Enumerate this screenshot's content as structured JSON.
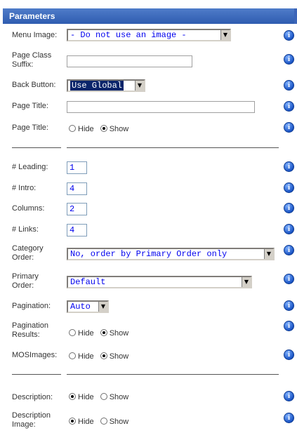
{
  "header": {
    "title": "Parameters"
  },
  "rows": {
    "menu_image": {
      "label": "Menu Image:",
      "value": "- Do not use an image -"
    },
    "page_class_suffix": {
      "label": "Page Class Suffix:",
      "value": ""
    },
    "back_button": {
      "label": "Back Button:",
      "value": "Use Global"
    },
    "page_title_text": {
      "label": "Page Title:",
      "value": ""
    },
    "page_title_show": {
      "label": "Page Title:",
      "hide": "Hide",
      "show": "Show",
      "selected": "Show"
    },
    "leading": {
      "label": "# Leading:",
      "value": "1"
    },
    "intro": {
      "label": "# Intro:",
      "value": "4"
    },
    "columns": {
      "label": "Columns:",
      "value": "2"
    },
    "links": {
      "label": "# Links:",
      "value": "4"
    },
    "category_order": {
      "label": "Category Order:",
      "value": "No, order by Primary Order only"
    },
    "primary_order": {
      "label": "Primary Order:",
      "value": "Default"
    },
    "pagination": {
      "label": "Pagination:",
      "value": "Auto"
    },
    "pagination_results": {
      "label": "Pagination Results:",
      "hide": "Hide",
      "show": "Show",
      "selected": "Show"
    },
    "mosimages": {
      "label": "MOSImages:",
      "hide": "Hide",
      "show": "Show",
      "selected": "Show"
    },
    "description": {
      "label": "Description:",
      "hide": "Hide",
      "show": "Show",
      "selected": "Hide"
    },
    "description_image": {
      "label": "Description Image:",
      "hide": "Hide",
      "show": "Show",
      "selected": "Hide"
    }
  },
  "info_icon_glyph": "i",
  "colors": {
    "header_bg": "#3c65b8",
    "select_text": "#0000ee",
    "selected_bg": "#0a246a",
    "info_icon": "#1a54c4"
  }
}
